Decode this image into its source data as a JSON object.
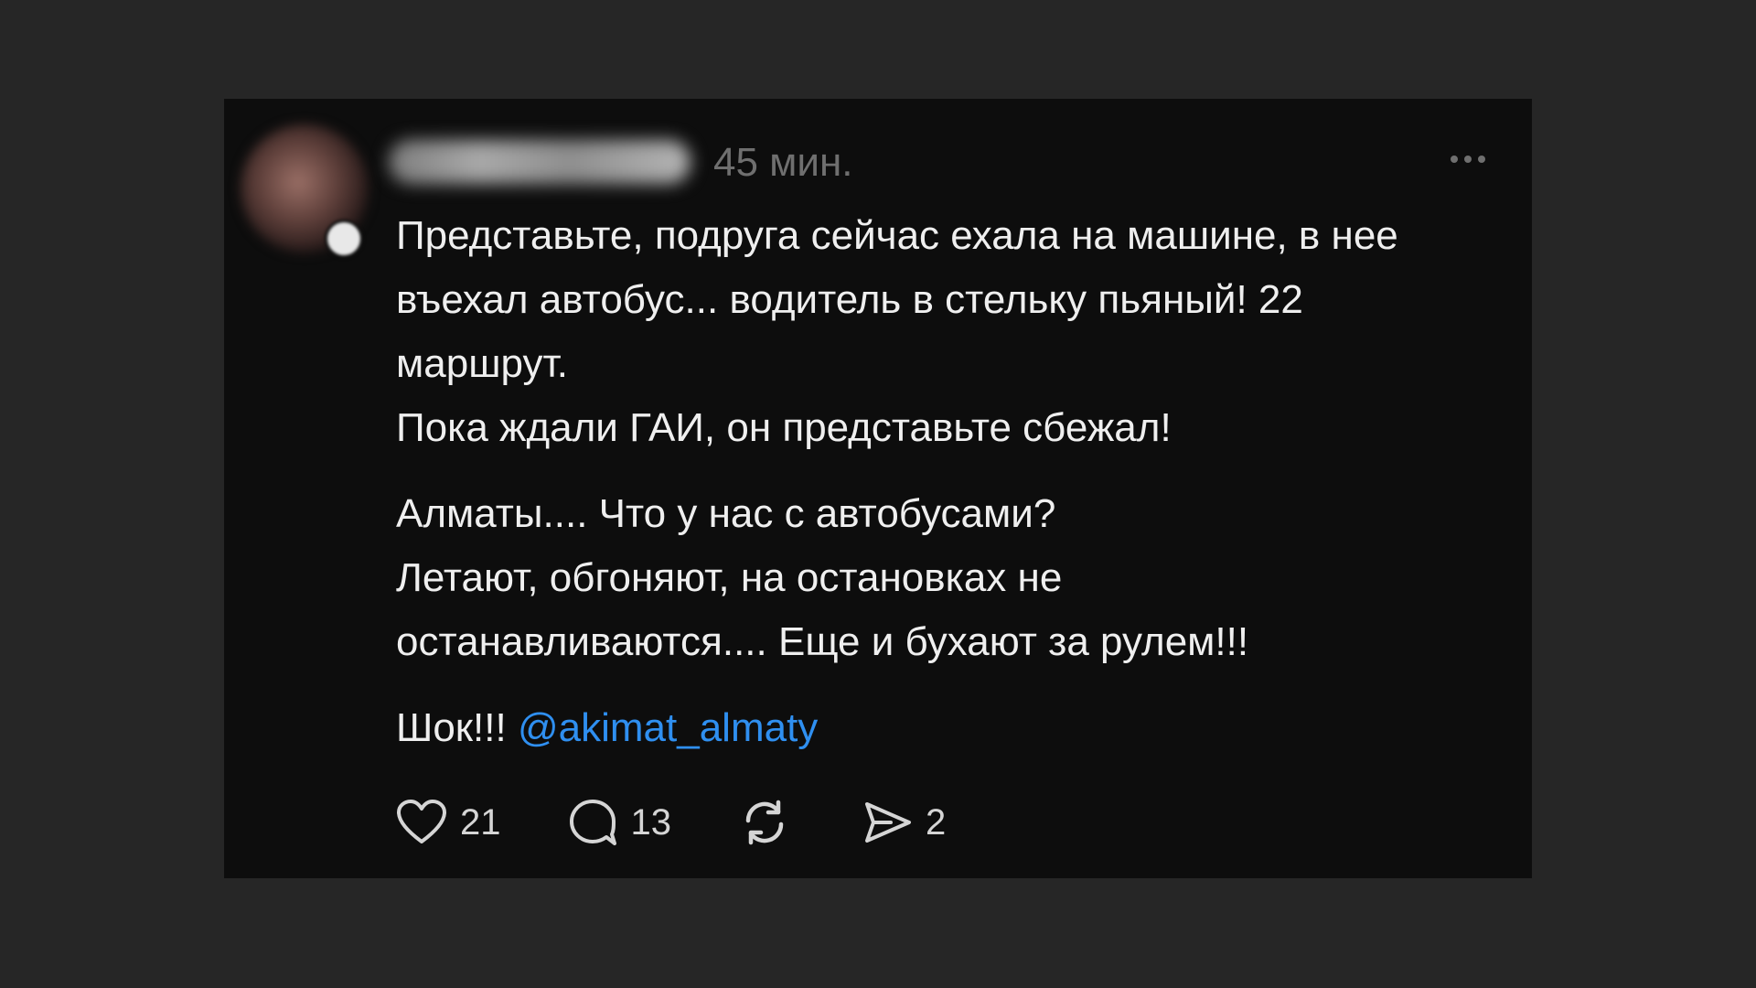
{
  "post": {
    "timestamp": "45 мин.",
    "paragraphs": [
      [
        "Представьте, подруга сейчас ехала на машине, в нее",
        "въехал автобус... водитель в стельку пьяный! 22",
        "маршрут.",
        "Пока ждали ГАИ, он представьте сбежал!"
      ],
      [
        "Алматы.... Что у нас с автобусами?",
        "Летают, обгоняют, на остановках не",
        "останавливаются.... Еще и бухают за рулем!!!"
      ]
    ],
    "final_text": "Шок!!!",
    "mention": "@akimat_almaty"
  },
  "actions": {
    "likes": "21",
    "comments": "13",
    "shares": "2"
  },
  "icons": {
    "like": "heart-icon",
    "comment": "comment-bubble-icon",
    "repost": "repost-icon",
    "share": "send-icon",
    "more": "more-dots-icon"
  },
  "colors": {
    "mention": "#2f8ff0",
    "background": "#0d0d0d"
  }
}
